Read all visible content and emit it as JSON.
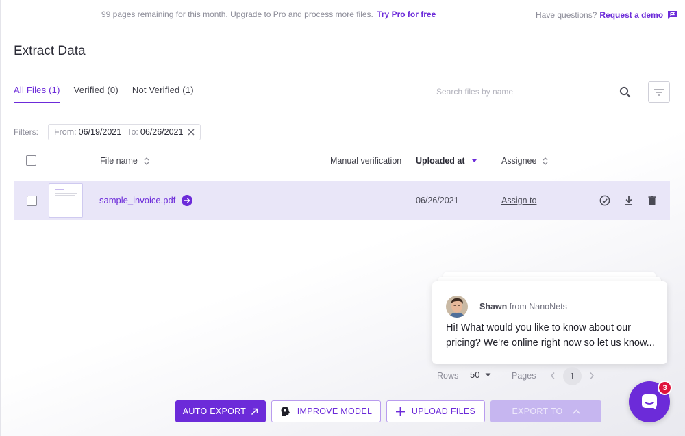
{
  "banner": {
    "text": "99 pages remaining for this month. Upgrade to Pro and process more files.",
    "link": "Try Pro for free"
  },
  "help": {
    "question": "Have questions?",
    "link": "Request a demo"
  },
  "page": {
    "title": "Extract Data"
  },
  "tabs": [
    {
      "label": "All Files (1)",
      "active": true
    },
    {
      "label": "Verified (0)",
      "active": false
    },
    {
      "label": "Not Verified (1)",
      "active": false
    }
  ],
  "search": {
    "placeholder": "Search files by name",
    "value": ""
  },
  "filters": {
    "label": "Filters:",
    "from_label": "From:",
    "from_value": "06/19/2021",
    "to_label": "To:",
    "to_value": "06/26/2021"
  },
  "table": {
    "columns": {
      "file_name": "File name",
      "manual_verification": "Manual verification",
      "uploaded_at": "Uploaded at",
      "assignee": "Assignee"
    },
    "rows": [
      {
        "file_name": "sample_invoice.pdf",
        "manual_verification": "",
        "uploaded_at": "06/26/2021",
        "assignee": "Assign to"
      }
    ]
  },
  "chat": {
    "author": "Shawn",
    "author_suffix": " from NanoNets",
    "message": "Hi!   What would you like to know about our pricing? We're online right now so let us know..."
  },
  "pagination": {
    "rows_label": "Rows",
    "rows_value": "50",
    "pages_label": "Pages",
    "current_page": "1"
  },
  "actions": {
    "auto_export": "AUTO EXPORT",
    "improve_model": "IMPROVE MODEL",
    "upload_files": "UPLOAD FILES",
    "export_to": "EXPORT TO"
  },
  "messenger": {
    "badge_count": "3"
  },
  "colors": {
    "accent": "#6c2bd9",
    "row_highlight": "#e9e6f8",
    "badge": "#e0143c"
  },
  "icons": [
    "demo-chat-icon",
    "search-icon",
    "filter-icon",
    "close-icon",
    "sort-icon",
    "caret-down-icon",
    "arrow-right-circle-icon",
    "check-circle-icon",
    "download-icon",
    "trash-icon",
    "chevron-left-icon",
    "chevron-right-icon",
    "external-arrow-icon",
    "brain-icon",
    "plus-icon",
    "chevron-up-icon",
    "messenger-icon"
  ]
}
